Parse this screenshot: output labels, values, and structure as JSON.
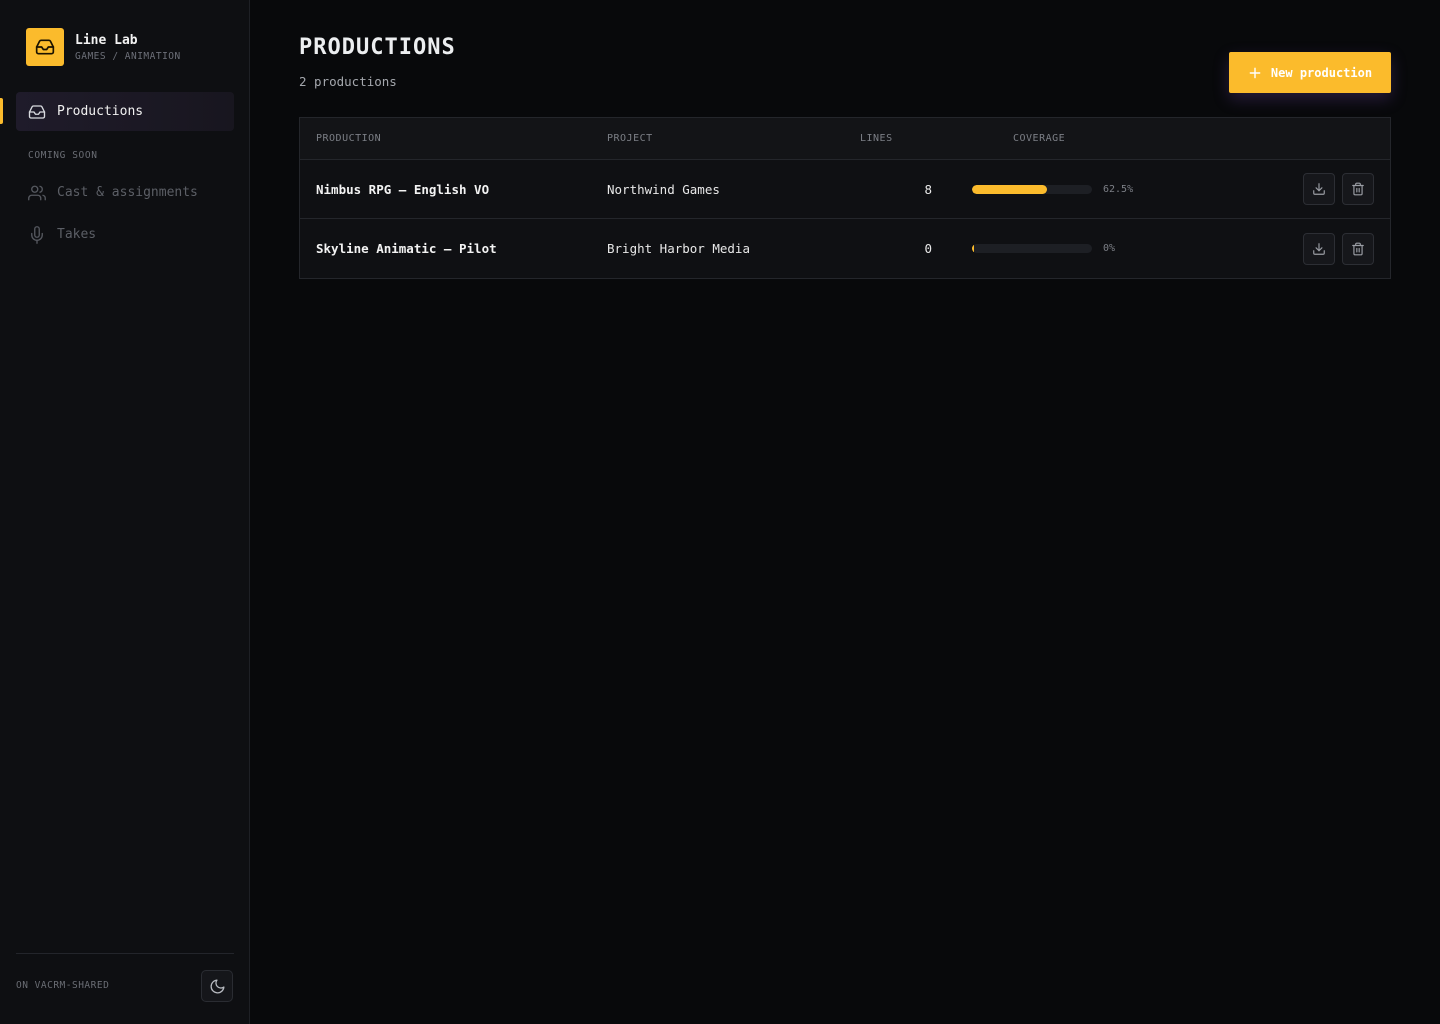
{
  "brand": {
    "name": "Line Lab",
    "subtitle": "GAMES / ANIMATION",
    "logo_icon": "inbox-tray-icon",
    "accent_color": "#fbbb2c"
  },
  "sidebar": {
    "active_item": {
      "label": "Productions",
      "icon": "inbox-tray-icon"
    },
    "section_label": "COMING SOON",
    "disabled_items": [
      {
        "label": "Cast & assignments",
        "icon": "users-icon"
      },
      {
        "label": "Takes",
        "icon": "microphone-icon"
      }
    ],
    "footer_label": "ON VACRM-SHARED",
    "theme_toggle_icon": "moon-icon"
  },
  "page": {
    "title": "PRODUCTIONS",
    "count_text": "2 productions",
    "new_button_label": "New production"
  },
  "table": {
    "headers": {
      "production": "PRODUCTION",
      "project": "PROJECT",
      "lines": "LINES",
      "coverage": "COVERAGE"
    },
    "rows": [
      {
        "production": "Nimbus RPG — English VO",
        "project": "Northwind Games",
        "lines": "8",
        "coverage_pct": 62.5,
        "coverage_label": "62.5%"
      },
      {
        "production": "Skyline Animatic — Pilot",
        "project": "Bright Harbor Media",
        "lines": "0",
        "coverage_pct": 0,
        "coverage_label": "0%"
      }
    ],
    "row_action_icons": [
      "download-icon",
      "trash-icon"
    ]
  }
}
